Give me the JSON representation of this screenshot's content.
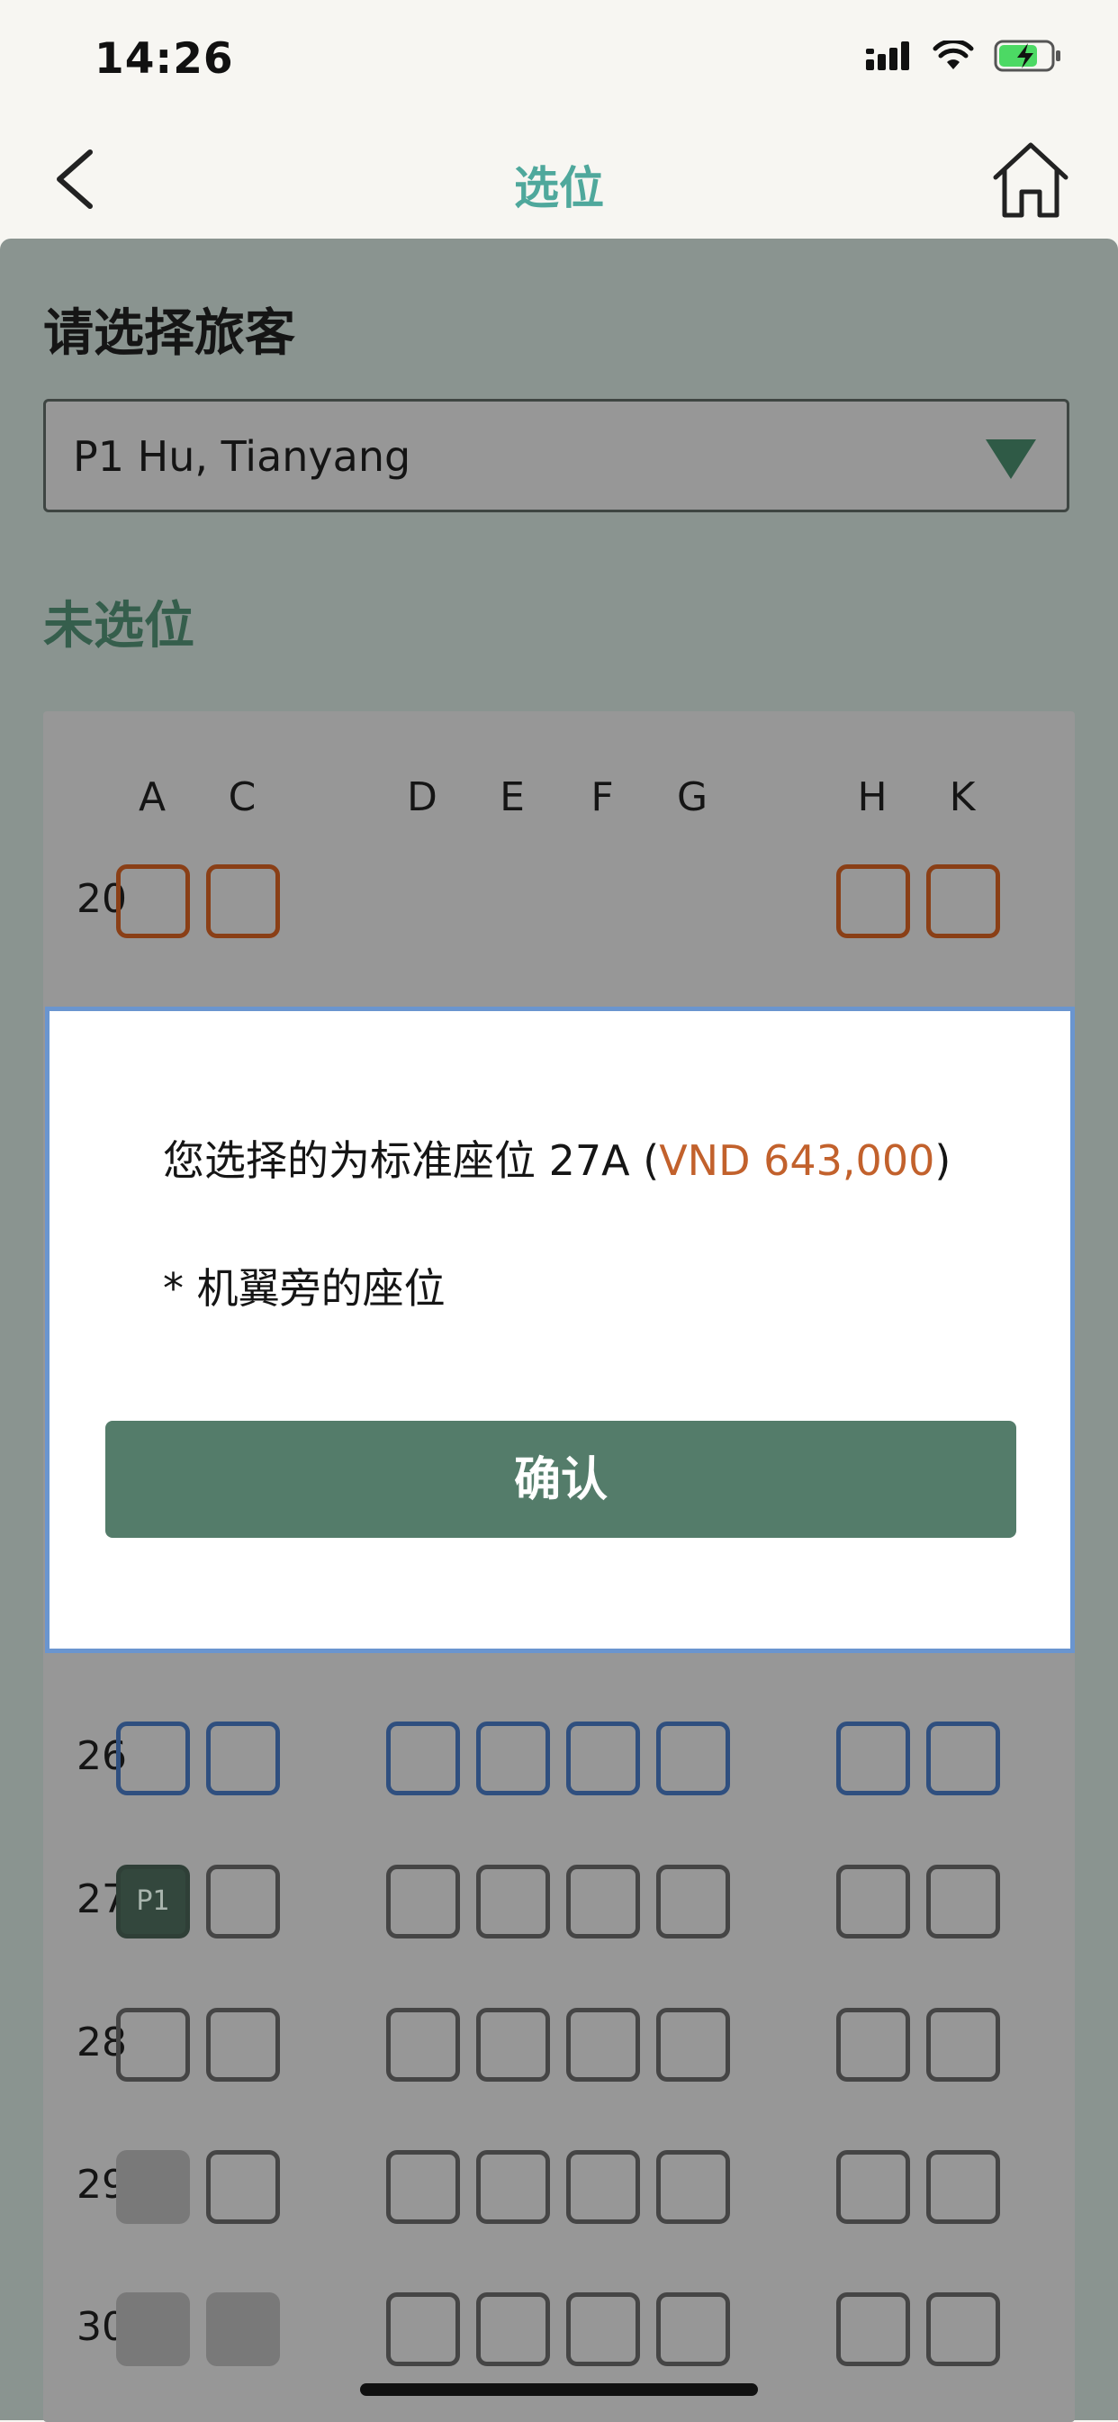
{
  "status_bar": {
    "time": "14:26"
  },
  "nav": {
    "title": "选位"
  },
  "passenger_section": {
    "title": "请选择旅客",
    "selected_passenger": "P1 Hu, Tianyang"
  },
  "seat_status_label": "未选位",
  "seat_map": {
    "columns": [
      "A",
      "C",
      "D",
      "E",
      "F",
      "G",
      "H",
      "K"
    ],
    "rows": [
      {
        "number": "20",
        "seats": {
          "A": "premium",
          "C": "premium",
          "H": "premium",
          "K": "premium"
        }
      },
      {
        "number": "26",
        "seats": {
          "A": "standard",
          "C": "standard",
          "D": "standard",
          "E": "standard",
          "F": "standard",
          "G": "standard",
          "H": "standard",
          "K": "standard"
        }
      },
      {
        "number": "27",
        "seats": {
          "A": "selected",
          "C": "available",
          "D": "available",
          "E": "available",
          "F": "available",
          "G": "available",
          "H": "available",
          "K": "available"
        }
      },
      {
        "number": "28",
        "seats": {
          "A": "available",
          "C": "available",
          "D": "available",
          "E": "available",
          "F": "available",
          "G": "available",
          "H": "available",
          "K": "available"
        }
      },
      {
        "number": "29",
        "seats": {
          "A": "taken",
          "C": "available",
          "D": "available",
          "E": "available",
          "F": "available",
          "G": "available",
          "H": "available",
          "K": "available"
        }
      },
      {
        "number": "30",
        "seats": {
          "A": "taken",
          "C": "taken",
          "D": "available",
          "E": "available",
          "F": "available",
          "G": "available",
          "H": "available",
          "K": "available"
        }
      }
    ],
    "selected_seat_label": "P1"
  },
  "modal": {
    "line1_prefix": "您选择的为标准座位 27A (",
    "price": "VND 643,000",
    "line1_suffix": ")",
    "line2": "* 机翼旁的座位",
    "confirm_label": "确认"
  },
  "colors": {
    "accent_title": "#4fa89c",
    "confirm_button": "#547c6a",
    "price": "#c2612c",
    "premium_seat": "#8a3f16",
    "standard_seat": "#2f4f7f"
  }
}
